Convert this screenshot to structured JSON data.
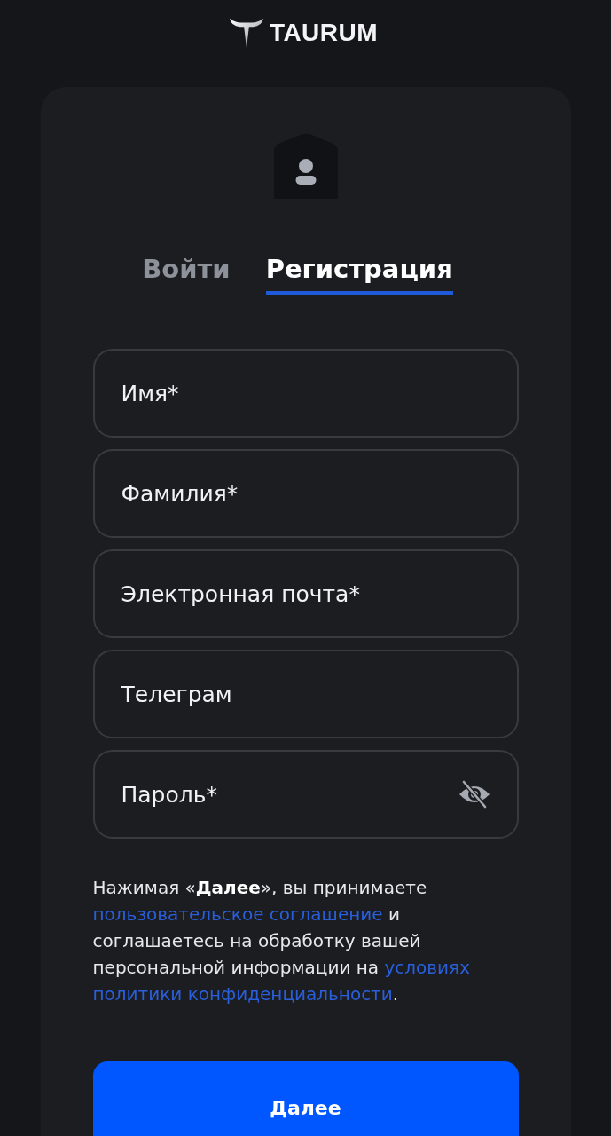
{
  "header": {
    "logo_text": "TAURUM"
  },
  "tabs": [
    {
      "label": "Войти",
      "selected": false
    },
    {
      "label": "Регистрация",
      "selected": true
    }
  ],
  "fields": [
    {
      "placeholder": "Имя*",
      "kind": "text"
    },
    {
      "placeholder": "Фамилия*",
      "kind": "text"
    },
    {
      "placeholder": "Электронная почта*",
      "kind": "text"
    },
    {
      "placeholder": "Телеграм",
      "kind": "text"
    },
    {
      "placeholder": "Пароль*",
      "kind": "password"
    }
  ],
  "consent": {
    "parts": [
      {
        "kind": "text",
        "text": "Нажимая «**Далее**», вы принимаете "
      },
      {
        "kind": "link",
        "text": "пользовательское соглашение"
      },
      {
        "kind": "text",
        "text": " и соглашаетесь на обработку вашей персональной информации на "
      },
      {
        "kind": "link",
        "text": "условиях"
      },
      {
        "kind": "link",
        "text": "политики конфиденциальности"
      },
      {
        "kind": "text",
        "text": "."
      }
    ]
  },
  "submit_button": {
    "label": "Далее"
  }
}
